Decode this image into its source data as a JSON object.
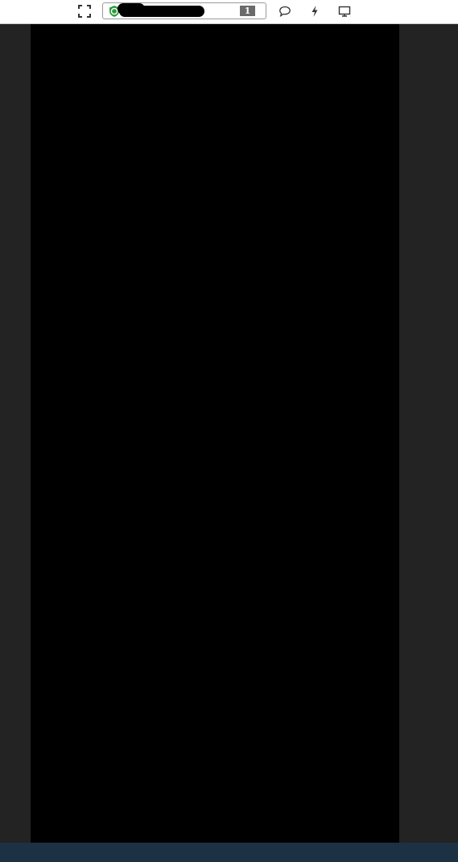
{
  "toolbar": {
    "fullscreen_icon": "fullscreen-expand-icon",
    "secure_icon": "shield-check-icon",
    "tab_count": "1",
    "comment_icon": "speech-bubble-icon",
    "lightning_icon": "lightning-bolt-icon",
    "screen_icon": "monitor-icon"
  },
  "colors": {
    "toolbar_bg": "#ffffff",
    "secure_green": "#2e9b3a",
    "content_bg": "#000000",
    "side_bg": "#232323",
    "bottom_bg": "#1d3145"
  }
}
